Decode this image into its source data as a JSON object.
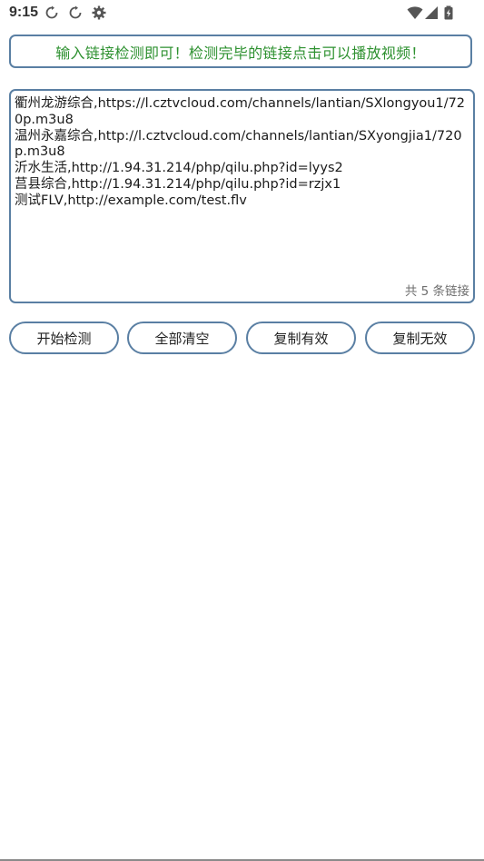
{
  "status_bar": {
    "time": "9:15",
    "left_icons": [
      "sync-icon",
      "sync-icon",
      "gear-icon"
    ],
    "right_icons": [
      "wifi-icon",
      "signal-icon",
      "battery-icon"
    ]
  },
  "notice": {
    "text": "输入链接检测即可！检测完毕的链接点击可以播放视频！",
    "color": "#2e9130"
  },
  "links_box": {
    "content": "衢州龙游综合,https://l.cztvcloud.com/channels/lantian/SXlongyou1/720p.m3u8\n温州永嘉综合,http://l.cztvcloud.com/channels/lantian/SXyongjia1/720p.m3u8\n沂水生活,http://1.94.31.214/php/qilu.php?id=lyys2\n莒县综合,http://1.94.31.214/php/qilu.php?id=rzjx1\n测试FLV,http://example.com/test.flv",
    "count_label": "共 5 条链接"
  },
  "buttons": {
    "start": "开始检测",
    "clear": "全部清空",
    "copy_valid": "复制有效",
    "copy_invalid": "复制无效"
  },
  "colors": {
    "border": "#5a7fa3",
    "notice_text": "#2e9130"
  }
}
